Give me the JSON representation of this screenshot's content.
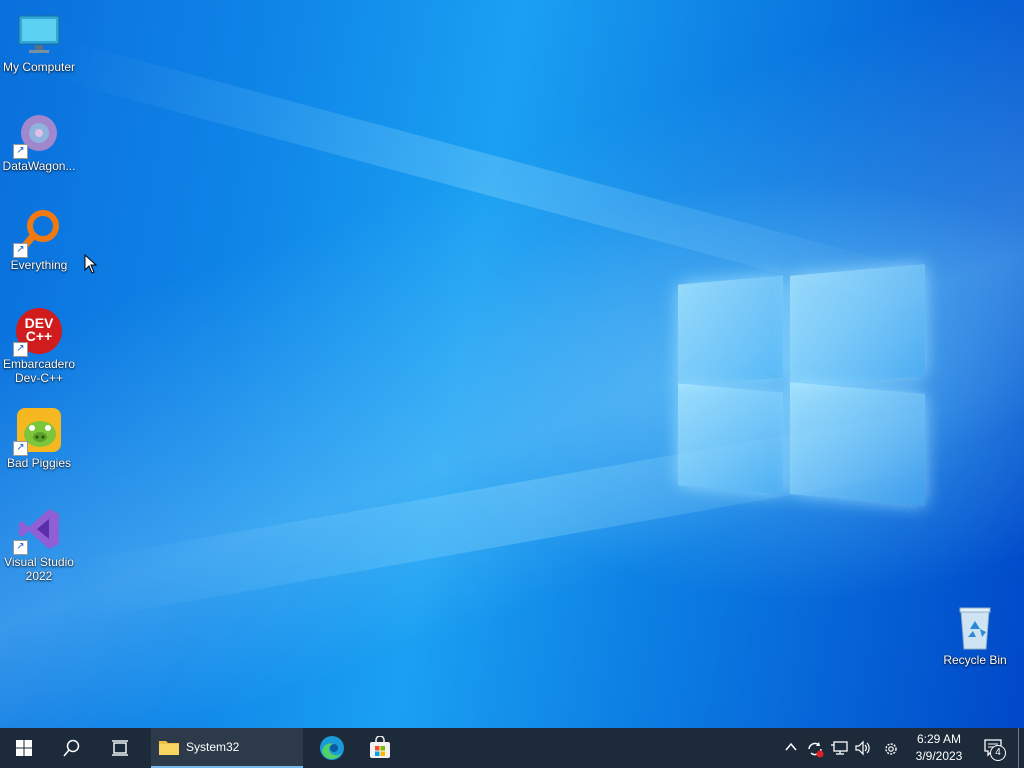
{
  "desktop": {
    "icons": [
      {
        "label": "My Computer",
        "icon": "monitor-icon",
        "shortcut": false
      },
      {
        "label": "DataWagon...",
        "icon": "datawagon-icon",
        "shortcut": true
      },
      {
        "label": "Everything",
        "icon": "magnifier-icon",
        "shortcut": true
      },
      {
        "label": "Embarcadero Dev-C++",
        "icon": "devcpp-icon",
        "shortcut": true,
        "icon_text": "DEV C++"
      },
      {
        "label": "Bad Piggies",
        "icon": "bad-piggies-icon",
        "shortcut": true
      },
      {
        "label": "Visual Studio 2022",
        "icon": "visual-studio-icon",
        "shortcut": true
      }
    ],
    "recycle_bin": {
      "label": "Recycle Bin",
      "icon": "recycle-bin-icon"
    }
  },
  "taskbar": {
    "start": {
      "icon": "windows-start-icon"
    },
    "search": {
      "icon": "search-icon"
    },
    "task_view": {
      "icon": "task-view-icon"
    },
    "apps": [
      {
        "label": "System32",
        "icon": "folder-icon",
        "active": true
      },
      {
        "label": "",
        "icon": "edge-icon"
      },
      {
        "label": "",
        "icon": "store-icon"
      }
    ],
    "tray": {
      "chevron": "chevron-up-icon",
      "icons": [
        "sync-icon",
        "network-icon",
        "volume-icon",
        "settings-gear-icon"
      ],
      "time": "6:29 AM",
      "date": "3/9/2023",
      "notification_count": "4"
    }
  },
  "colors": {
    "taskbar_bg": "#1c2a3a",
    "accent": "#76b9ed"
  }
}
